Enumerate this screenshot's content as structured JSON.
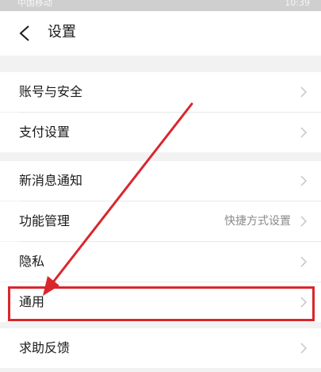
{
  "statusbar": {
    "carrier": "中国移动",
    "time": "10:39"
  },
  "navbar": {
    "title": "设置"
  },
  "rows": [
    {
      "label": "账号与安全"
    },
    {
      "label": "支付设置"
    },
    {
      "label": "新消息通知"
    },
    {
      "label": "功能管理",
      "value": "快捷方式设置"
    },
    {
      "label": "隐私"
    },
    {
      "label": "通用"
    },
    {
      "label": "求助反馈"
    }
  ],
  "colors": {
    "annotation": "#d9262c",
    "background": "#f2f2f2"
  },
  "icons": {
    "back": "chevron-left-icon",
    "row": "chevron-right-icon",
    "annotation": "arrow-annotation-icon"
  }
}
